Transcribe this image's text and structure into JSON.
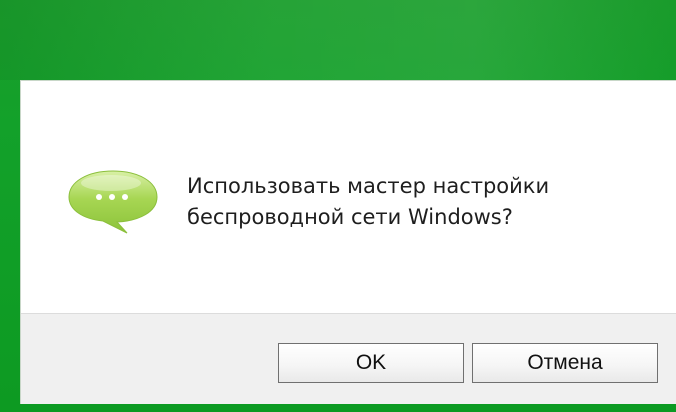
{
  "dialog": {
    "message_line1": "Использовать мастер настройки",
    "message_line2": "беспроводной сети Windows?",
    "icon": "speech-bubble-icon"
  },
  "buttons": {
    "ok_label": "OK",
    "cancel_label": "Отмена"
  },
  "colors": {
    "frame": "#13a12a",
    "icon_bubble": "#9bd048",
    "button_area": "#f0f0f0"
  }
}
